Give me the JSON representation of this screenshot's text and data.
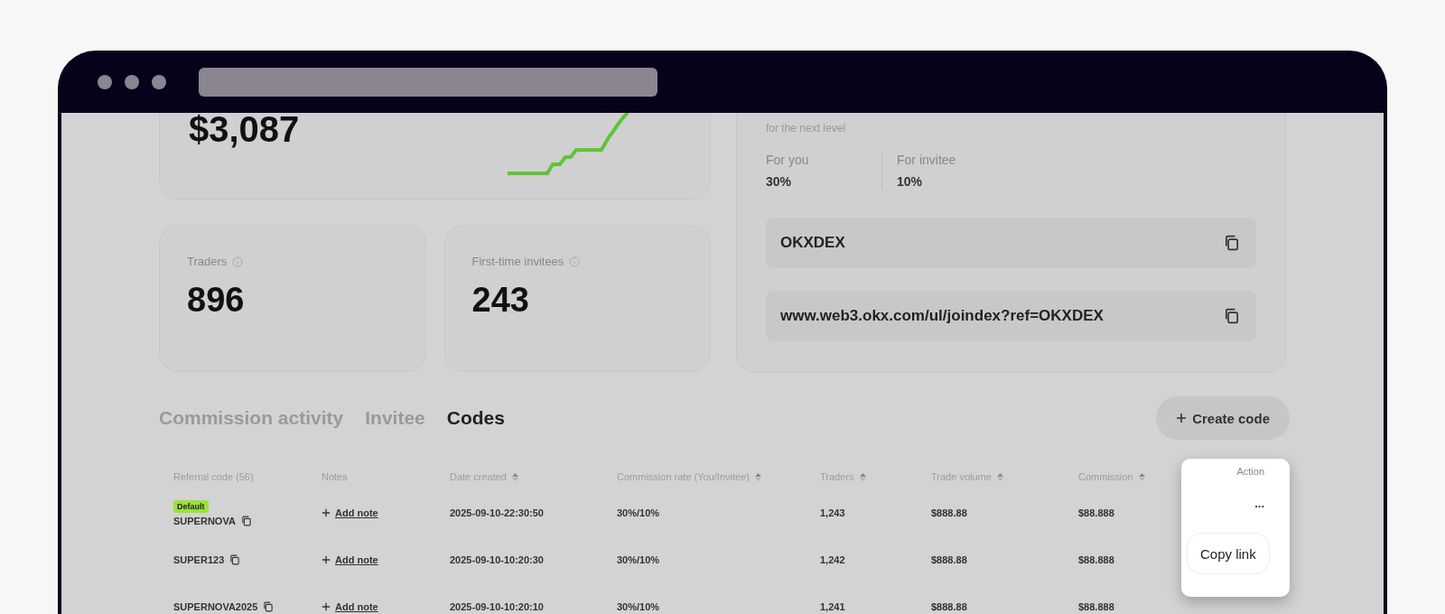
{
  "summary": {
    "value": "$3,087"
  },
  "stats": [
    {
      "label": "Traders",
      "value": "896"
    },
    {
      "label": "First-time invitees",
      "value": "243"
    }
  ],
  "rate_card": {
    "note": "for the next level",
    "rates": [
      {
        "label": "For you",
        "value": "30%"
      },
      {
        "label": "For invitee",
        "value": "10%"
      }
    ],
    "fields": [
      {
        "value": "OKXDEX"
      },
      {
        "value": "www.web3.okx.com/ul/joindex?ref=OKXDEX"
      }
    ]
  },
  "tabs": [
    {
      "label": "Commission activity",
      "selected": false
    },
    {
      "label": "Invitee",
      "selected": false
    },
    {
      "label": "Codes",
      "selected": true
    }
  ],
  "create_button": {
    "label": "Create code"
  },
  "table": {
    "columns": [
      {
        "label": "Referral code (56)",
        "sortable": false
      },
      {
        "label": "Notes",
        "sortable": false
      },
      {
        "label": "Date created",
        "sortable": true
      },
      {
        "label": "Commission rate (You/Invitee)",
        "sortable": true
      },
      {
        "label": "Traders",
        "sortable": true
      },
      {
        "label": "Trade volume",
        "sortable": true
      },
      {
        "label": "Commission",
        "sortable": true
      }
    ],
    "action_column": "Action",
    "rows": [
      {
        "badge": "Default",
        "code": "SUPERNOVA",
        "note": "Add note",
        "date": "2025-09-10-22:30:50",
        "rate": "30%/10%",
        "traders": "1,243",
        "volume": "$888.88",
        "commission": "$88.888",
        "action": "..."
      },
      {
        "code": "SUPER123",
        "note": "Add note",
        "date": "2025-09-10-10:20:30",
        "rate": "30%/10%",
        "traders": "1,242",
        "volume": "$888.88",
        "commission": "$88.888"
      },
      {
        "code": "SUPERNOVA2025",
        "note": "Add note",
        "date": "2025-09-10-10:20:10",
        "rate": "30%/10%",
        "traders": "1,241",
        "volume": "$888.88",
        "commission": "$88.888"
      }
    ]
  },
  "popup": {
    "button": "Copy link"
  }
}
